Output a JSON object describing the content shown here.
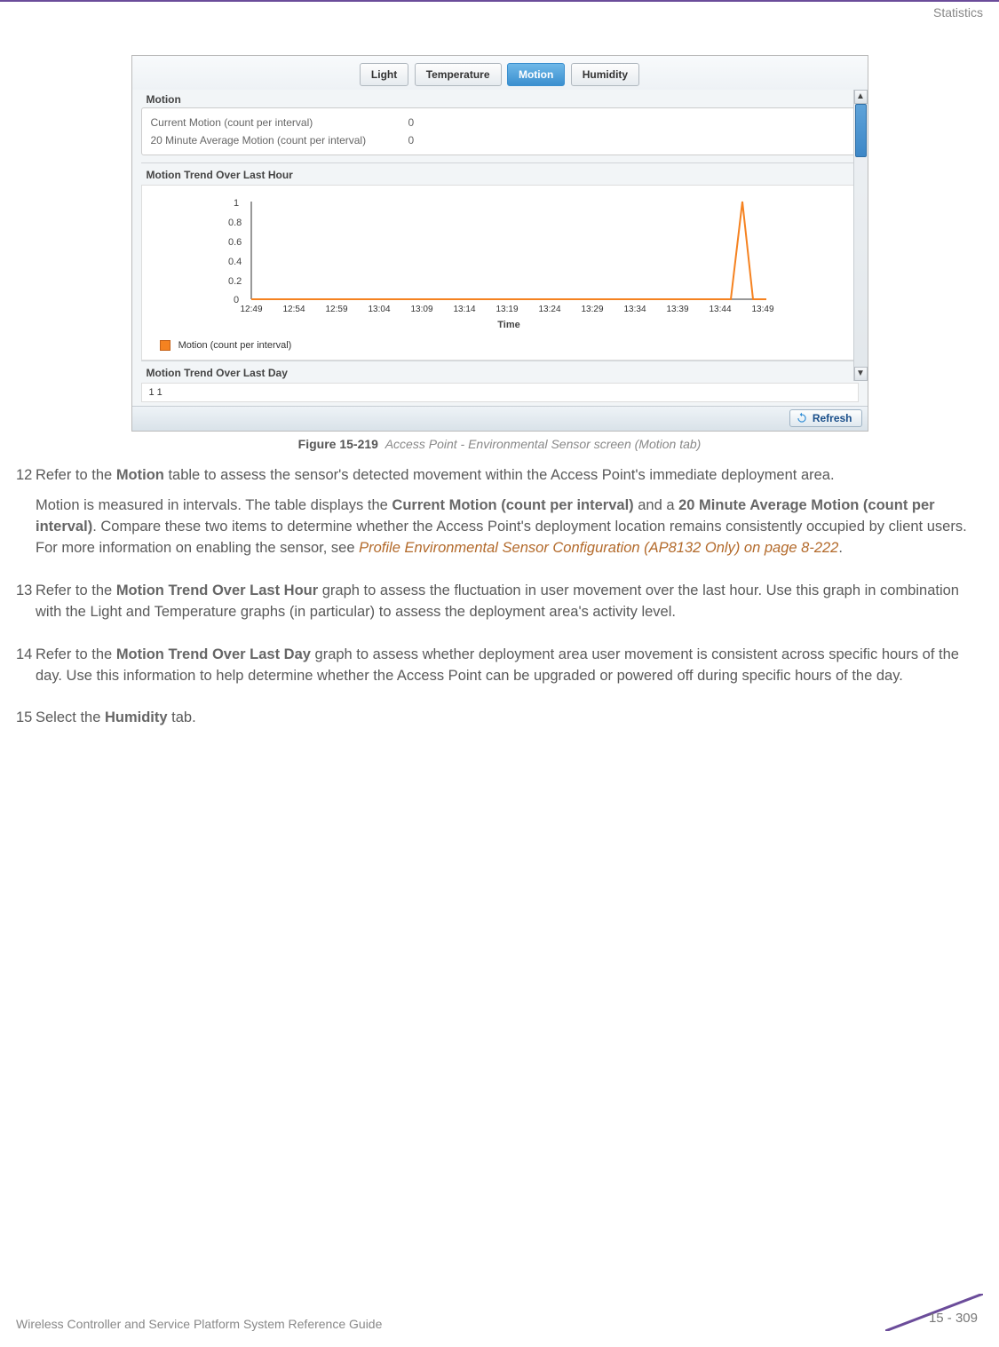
{
  "header": {
    "section": "Statistics"
  },
  "screenshot": {
    "tabs": [
      "Light",
      "Temperature",
      "Motion",
      "Humidity"
    ],
    "activeTab": "Motion",
    "panelTitle": "Motion",
    "table": {
      "rows": [
        {
          "label": "Current Motion (count per interval)",
          "value": "0"
        },
        {
          "label": "20 Minute Average Motion (count per interval)",
          "value": "0"
        }
      ]
    },
    "hourSection": "Motion Trend Over Last Hour",
    "daySection": "Motion Trend Over Last Day",
    "xAxisLabel": "Time",
    "legend": "Motion (count per interval)",
    "dayAxisStart": "1   1",
    "refresh": "Refresh"
  },
  "chart_data": {
    "type": "line",
    "title": "Motion Trend Over Last Hour",
    "xlabel": "Time",
    "ylabel": "",
    "ylim": [
      0,
      1
    ],
    "yticks": [
      0,
      0.2,
      0.4,
      0.6,
      0.8,
      1
    ],
    "categories": [
      "12:49",
      "12:54",
      "12:59",
      "13:04",
      "13:09",
      "13:14",
      "13:19",
      "13:24",
      "13:29",
      "13:34",
      "13:39",
      "13:44",
      "13:49"
    ],
    "series": [
      {
        "name": "Motion (count per interval)",
        "color": "#f58220",
        "values": [
          0,
          0,
          0,
          0,
          0,
          0,
          0,
          0,
          0,
          0,
          0,
          0,
          1
        ]
      }
    ]
  },
  "figure": {
    "label": "Figure 15-219",
    "caption": "Access Point - Environmental Sensor screen (Motion tab)"
  },
  "items": {
    "12": {
      "p1a": "Refer to the ",
      "p1b": "Motion",
      "p1c": " table to assess the sensor's detected movement within the Access Point's immediate deployment area.",
      "p2a": "Motion is measured in intervals. The table displays the ",
      "p2b": "Current Motion (count per interval)",
      "p2c": " and a ",
      "p2d": "20 Minute Average Motion (count per interval)",
      "p2e": ". Compare these two items to determine whether the Access Point's deployment location remains consistently occupied by client users. For more information on enabling the sensor, see ",
      "p2f": "Profile Environmental Sensor Configuration (AP8132 Only) on page 8-222",
      "p2g": "."
    },
    "13": {
      "a": "Refer to the ",
      "b": "Motion Trend Over Last Hour",
      "c": " graph to assess the fluctuation in user movement over the last hour. Use this graph in combination with the Light and Temperature graphs (in particular) to assess the deployment area's activity level."
    },
    "14": {
      "a": "Refer to the ",
      "b": "Motion Trend Over Last Day",
      "c": " graph to assess whether deployment area user movement is consistent across specific hours of the day. Use this information to help determine whether the Access Point can be upgraded or powered off during specific hours of the day."
    },
    "15": {
      "a": "Select the ",
      "b": "Humidity",
      "c": " tab."
    }
  },
  "nums": {
    "n12": "12",
    "n13": "13",
    "n14": "14",
    "n15": "15"
  },
  "footer": {
    "left": "Wireless Controller and Service Platform System Reference Guide",
    "page": "15 - 309"
  }
}
